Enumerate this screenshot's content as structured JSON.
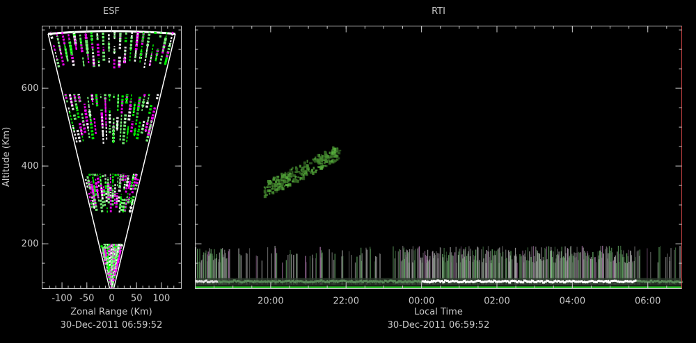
{
  "chart_data": [
    {
      "type": "heatmap",
      "title": "ESF",
      "xlabel": "Zonal Range (Km)",
      "ylabel": "Altitude (Km)",
      "timestamp": "30-Dec-2011 06:59:52",
      "xlim": [
        -140,
        140
      ],
      "ylim": [
        85,
        760
      ],
      "xtick_labels": [
        "-100",
        "-50",
        "0",
        "50",
        "100"
      ],
      "xtick_values": [
        -100,
        -50,
        0,
        50,
        100
      ],
      "ytick_labels": [
        "200",
        "400",
        "600"
      ],
      "ytick_values": [
        200,
        400,
        600
      ],
      "fan_apex_altitude": 85,
      "fan_top_altitude": 740,
      "echo_layers": [
        {
          "bottom": 85,
          "top": 200
        },
        {
          "bottom": 280,
          "top": 380
        },
        {
          "bottom": 455,
          "top": 585
        },
        {
          "bottom": 650,
          "top": 745
        }
      ],
      "colors": [
        "#00ff00",
        "#ffffff",
        "#ff00ff",
        "#7fff7f"
      ]
    },
    {
      "type": "heatmap",
      "title": "RTI",
      "xlabel": "Local Time",
      "timestamp": "30-Dec-2011 06:59:52",
      "xlim_hours": [
        18.0,
        30.9
      ],
      "ylim": [
        85,
        760
      ],
      "xtick_labels": [
        "20:00",
        "22:00",
        "00:00",
        "02:00",
        "04:00",
        "06:00"
      ],
      "xtick_hours": [
        20,
        22,
        24,
        26,
        28,
        30
      ],
      "ytick_values": [
        200,
        400,
        600
      ],
      "features": [
        {
          "kind": "plume",
          "start_hour": 19.8,
          "end_hour": 21.8,
          "alt_low": 320,
          "alt_high": 450,
          "color": "#3a8a2a"
        },
        {
          "kind": "low_band",
          "start_hour": 18.0,
          "end_hour": 30.9,
          "alt_low": 90,
          "alt_high": 195,
          "color": "#9a9a9a"
        },
        {
          "kind": "bright_layer",
          "start_hour": 18.0,
          "end_hour": 30.9,
          "alt_low": 92,
          "alt_high": 110,
          "color": "#ffffff"
        }
      ]
    }
  ]
}
